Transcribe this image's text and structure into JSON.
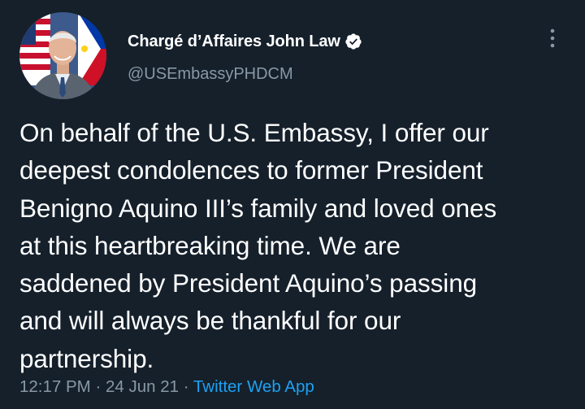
{
  "author": {
    "display_name": "Chargé d’Affaires John Law",
    "handle": "@USEmbassyPHDCM",
    "verified": true,
    "avatar_icon": "profile-photo"
  },
  "tweet": {
    "text": "On behalf of the U.S. Embassy, I offer our\ndeepest condolences to former President\nBenigno Aquino III’s family and loved ones\nat this heartbreaking time.  We are\nsaddened by President Aquino’s passing\nand will always be thankful for our\npartnership.",
    "time": "12:17 PM",
    "separator": " · ",
    "date": "24 Jun 21",
    "source": "Twitter Web App"
  },
  "colors": {
    "background": "#15202b",
    "secondary_text": "#8899a6",
    "link": "#1da1f2"
  },
  "icons": {
    "more": "more-vertical-icon",
    "verified": "verified-badge-icon"
  }
}
